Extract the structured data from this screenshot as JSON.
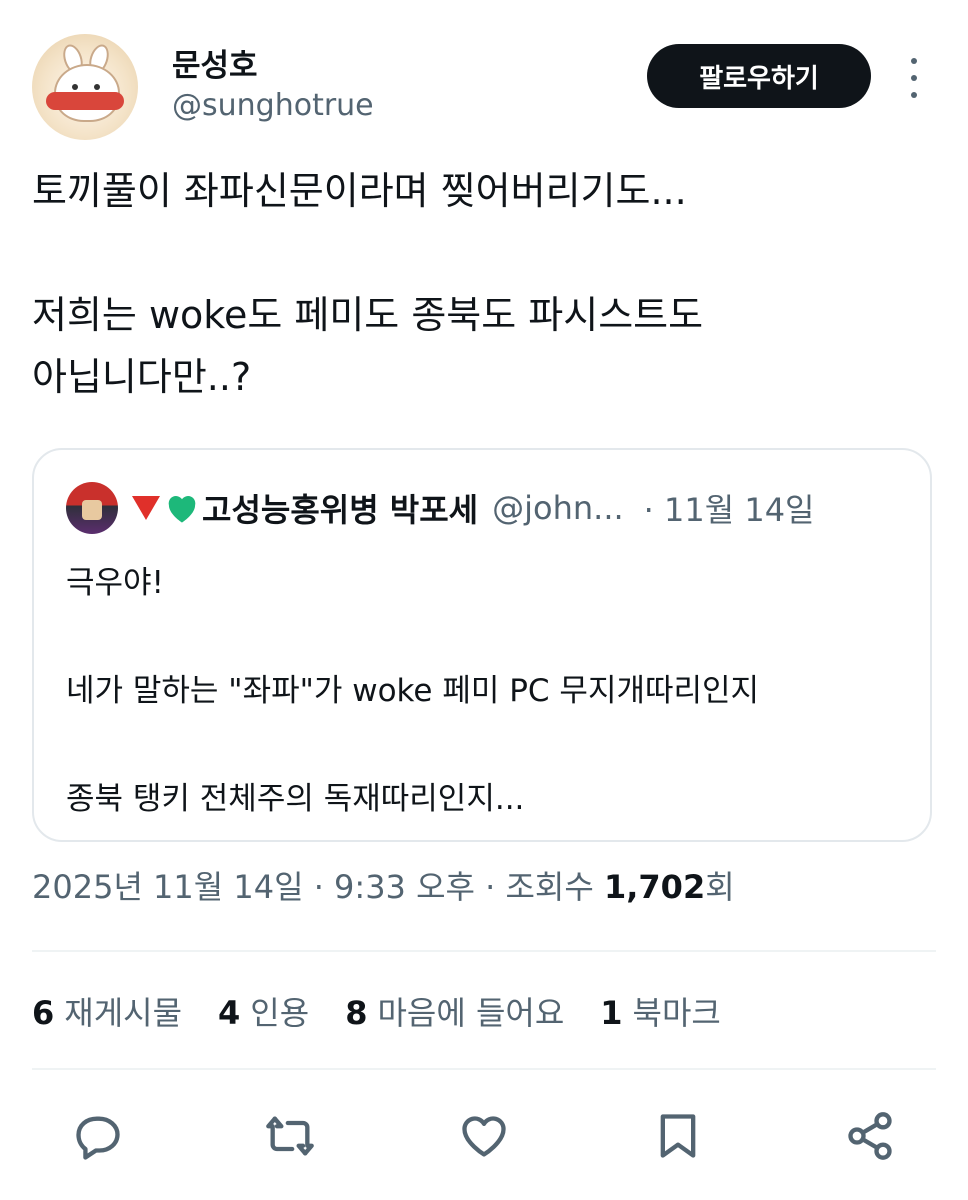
{
  "author": {
    "display_name": "문성호",
    "handle": "@sunghotrue",
    "follow_label": "팔로우하기"
  },
  "tweet": {
    "text": "토끼풀이 좌파신문이라며 찢어버리기도...\n\n저희는 woke도 페미도 종북도 파시스트도\n아닙니다만..?"
  },
  "quote": {
    "name": "고성능홍위병 박포세",
    "handle": "@john...",
    "date": "· 11월 14일",
    "text": "극우야!\n\n네가 말하는 \"좌파\"가 woke 페미 PC 무지개따리인지\n\n종북 탱키 전체주의 독재따리인지..."
  },
  "meta": {
    "date_time": "2025년 11월 14일 · 9:33 오후 · 조회수",
    "views": "1,702",
    "views_suffix": "회"
  },
  "stats": [
    {
      "num": "6",
      "label": "재게시물"
    },
    {
      "num": "4",
      "label": "인용"
    },
    {
      "num": "8",
      "label": "마음에 들어요"
    },
    {
      "num": "1",
      "label": "북마크"
    }
  ],
  "icons": {
    "reply": "reply-icon",
    "retweet": "retweet-icon",
    "like": "heart-icon",
    "bookmark": "bookmark-icon",
    "share": "share-icon"
  },
  "colors": {
    "text": "#0f1419",
    "secondary": "#536471",
    "border": "#e3e8ec",
    "follow_bg": "#0f1419"
  }
}
